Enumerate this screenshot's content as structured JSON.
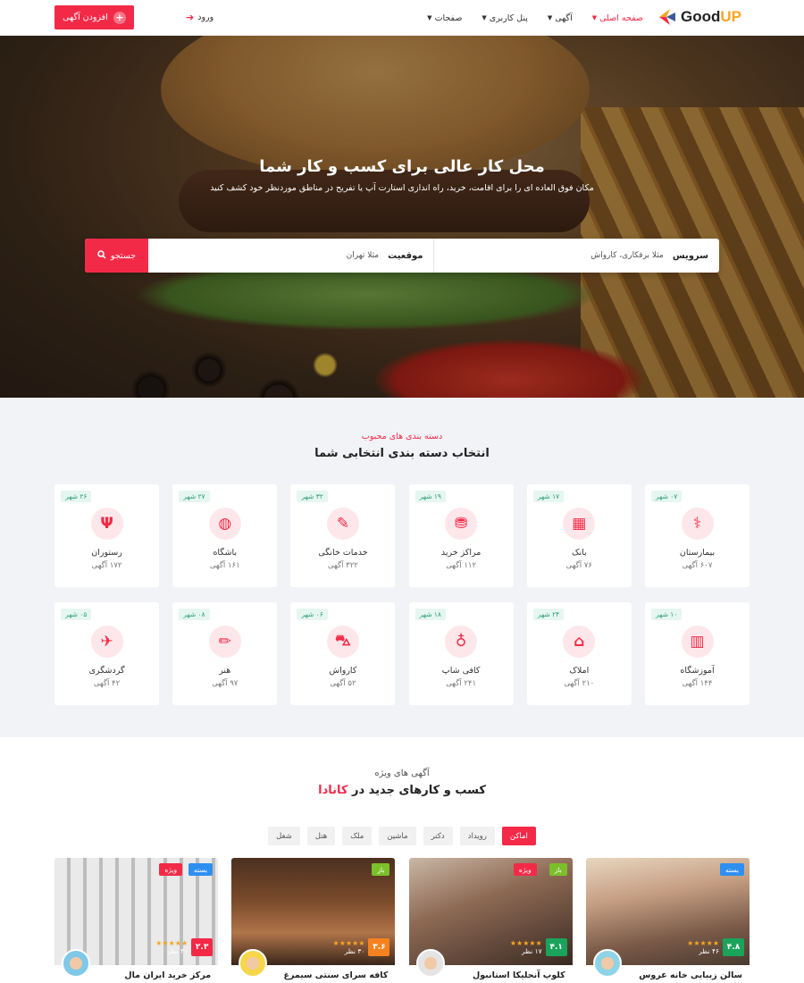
{
  "header": {
    "logo_text_main": "Good",
    "logo_text_accent": "UP",
    "nav": [
      {
        "label": "صفحه اصلی",
        "active": true
      },
      {
        "label": "آگهی",
        "active": false
      },
      {
        "label": "پنل کاربری",
        "active": false
      },
      {
        "label": "صفحات",
        "active": false
      }
    ],
    "login_label": "ورود",
    "add_listing_label": "افزودن آگهی"
  },
  "hero": {
    "title": "محل کار عالی برای کسب و کار شما",
    "subtitle": "مکان فوق العاده ای را برای اقامت، خرید، راه اندازی استارت آپ یا تفریح در مناطق موردنظر خود کشف کنید",
    "search": {
      "service_label": "سرویس",
      "service_placeholder": "مثلا برقکاری، کارواش",
      "location_label": "موقعیت",
      "location_placeholder": "مثلا تهران",
      "button_label": "جستجو"
    }
  },
  "categories": {
    "pretitle": "دسته بندی های محبوب",
    "title": "انتخاب دسته بندی انتخابی شما",
    "items": [
      {
        "name": "بیمارستان",
        "count": "۶۰۷ آگهی",
        "cities": "۰۷ شهر",
        "icon": "stethoscope-icon",
        "glyph": "⚕"
      },
      {
        "name": "بانک",
        "count": "۷۶ آگهی",
        "cities": "۱۷ شهر",
        "icon": "bank-building-icon",
        "glyph": "▦"
      },
      {
        "name": "مراکز خرید",
        "count": "۱۱۲ آگهی",
        "cities": "۱۹ شهر",
        "icon": "shopping-basket-icon",
        "glyph": "⛃"
      },
      {
        "name": "خدمات خانگی",
        "count": "۳۲۲ آگهی",
        "cities": "۳۲ شهر",
        "icon": "brush-icon",
        "glyph": "✎"
      },
      {
        "name": "باشگاه",
        "count": "۱۶۱ آگهی",
        "cities": "۲۷ شهر",
        "icon": "basketball-icon",
        "glyph": "◍"
      },
      {
        "name": "رستوران",
        "count": "۱۷۲ آگهی",
        "cities": "۲۶ شهر",
        "icon": "cutlery-icon",
        "glyph": "Ψ"
      },
      {
        "name": "آموزشگاه",
        "count": "۱۴۴ آگهی",
        "cities": "۱۰ شهر",
        "icon": "book-icon",
        "glyph": "▥"
      },
      {
        "name": "املاک",
        "count": "۲۱۰ آگهی",
        "cities": "۲۴ شهر",
        "icon": "house-icon",
        "glyph": "⌂"
      },
      {
        "name": "کافی شاپ",
        "count": "۲۴۱ آگهی",
        "cities": "۱۸ شهر",
        "icon": "wine-glass-icon",
        "glyph": "♁"
      },
      {
        "name": "کارواش",
        "count": "۵۲ آگهی",
        "cities": "۰۶ شهر",
        "icon": "car-icon",
        "glyph": "⛍"
      },
      {
        "name": "هنر",
        "count": "۹۷ آگهی",
        "cities": "۰۸ شهر",
        "icon": "pencil-ruler-icon",
        "glyph": "✏"
      },
      {
        "name": "گردشگری",
        "count": "۴۲ آگهی",
        "cities": "۰۵ شهر",
        "icon": "airplane-icon",
        "glyph": "✈"
      }
    ]
  },
  "featured": {
    "pretitle": "آگهی های ویژه",
    "title_prefix": "کسب و کارهای جدید در",
    "title_highlight": "کانادا",
    "filters": [
      {
        "label": "اماکن",
        "active": true
      },
      {
        "label": "رویداد",
        "active": false
      },
      {
        "label": "دکتر",
        "active": false
      },
      {
        "label": "ماشین",
        "active": false
      },
      {
        "label": "ملک",
        "active": false
      },
      {
        "label": "هتل",
        "active": false
      },
      {
        "label": "شغل",
        "active": false
      }
    ],
    "listings": [
      {
        "title": "سالن زیبایی خانه عروس",
        "rating": "۴.۸",
        "rating_color": "#1aa35a",
        "reviews": "۴۶ نظر",
        "badges": [
          {
            "label": "بسته",
            "color": "b-blue"
          }
        ]
      },
      {
        "title": "کلوپ آنجلیکا استانبول",
        "rating": "۴.۱",
        "rating_color": "#1aa35a",
        "reviews": "۱۷ نظر",
        "badges": [
          {
            "label": "باز",
            "color": "b-green"
          },
          {
            "label": "ویژه",
            "color": "b-red"
          }
        ]
      },
      {
        "title": "کافه سرای سنتی سیمرغ",
        "rating": "۳.۶",
        "rating_color": "#f5821f",
        "reviews": "۳۰ نظر",
        "badges": [
          {
            "label": "باز",
            "color": "b-green"
          }
        ]
      },
      {
        "title": "مرکز خرید ایران مال",
        "rating": "۲.۳",
        "rating_color": "#f32a47",
        "reviews": "۴۱ نظر",
        "badges": [
          {
            "label": "بسته",
            "color": "b-blue"
          },
          {
            "label": "ویژه",
            "color": "b-red"
          }
        ]
      }
    ],
    "stars": "★★★★★"
  },
  "colors": {
    "accent": "#f32a47",
    "background_section": "#f2f3f7"
  }
}
